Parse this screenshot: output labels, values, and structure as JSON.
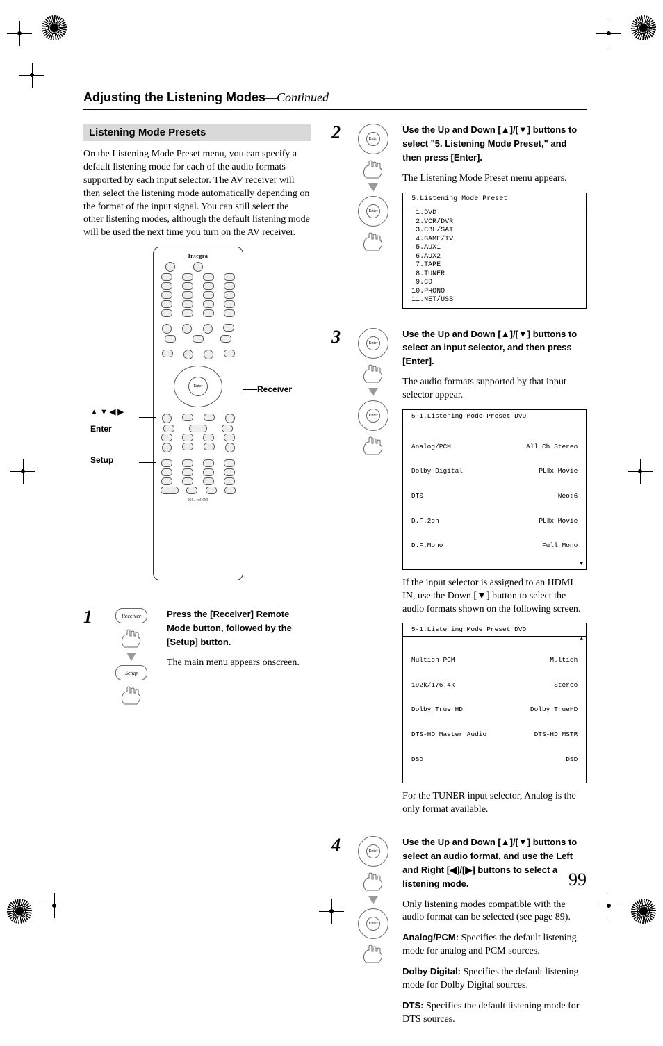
{
  "header": {
    "title": "Adjusting the Listening Modes",
    "continued": "—Continued"
  },
  "left": {
    "section_title": "Listening Mode Presets",
    "intro": "On the Listening Mode Preset menu, you can specify a default listening mode for each of the audio formats supported by each input selector. The AV receiver will then select the listening mode automatically depending on the format of the input signal. You can still select the other listening modes, although the default listening mode will be used the next time you turn on the AV receiver.",
    "remote": {
      "brand": "Integra",
      "model": "RC-688M"
    },
    "callouts": {
      "receiver": "Receiver",
      "arrows_symbols": "▲ ▼ ◀ ▶",
      "enter": "Enter",
      "setup": "Setup"
    },
    "step1": {
      "number": "1",
      "receiver_btn": "Receiver",
      "setup_btn": "Setup",
      "bold": "Press the [Receiver] Remote Mode button, followed by the [Setup] button.",
      "body": "The main menu appears onscreen."
    }
  },
  "right": {
    "step2": {
      "number": "2",
      "enter_label": "Enter",
      "bold_a": "Use the Up and Down [",
      "bold_b": "]/[",
      "bold_c": "] buttons to select \"5. Listening Mode Preset,\" and then press [Enter].",
      "body": "The Listening Mode Preset menu appears.",
      "osd": {
        "title": " 5.Listening Mode Preset",
        "lines": "  1.DVD\n  2.VCR/DVR\n  3.CBL/SAT\n  4.GAME/TV\n  5.AUX1\n  6.AUX2\n  7.TAPE\n  8.TUNER\n  9.CD\n 10.PHONO\n 11.NET/USB"
      }
    },
    "step3": {
      "number": "3",
      "enter_label": "Enter",
      "bold_a": "Use the Up and Down [",
      "bold_b": "]/[",
      "bold_c": "] buttons to select an input selector, and then press [Enter].",
      "body1": "The audio formats supported by that input selector appear.",
      "osd1": {
        "title": " 5-1.Listening Mode Preset DVD",
        "rows": [
          {
            "l": " Analog/PCM",
            "r": "All Ch Stereo "
          },
          {
            "l": " Dolby Digital",
            "r": "PLⅡx Movie "
          },
          {
            "l": " DTS",
            "r": "Neo:6 "
          },
          {
            "l": " D.F.2ch",
            "r": "PLⅡx Movie "
          },
          {
            "l": " D.F.Mono",
            "r": "Full Mono "
          }
        ]
      },
      "body2": "If the input selector is assigned to an HDMI IN, use the Down [▼] button to select the audio formats shown on the following screen.",
      "osd2": {
        "title": " 5-1.Listening Mode Preset DVD",
        "rows": [
          {
            "l": " Multich PCM",
            "r": "Multich "
          },
          {
            "l": " 192k/176.4k",
            "r": "Stereo "
          },
          {
            "l": " Dolby True HD",
            "r": "Dolby TrueHD "
          },
          {
            "l": " DTS-HD Master Audio",
            "r": "DTS-HD MSTR "
          },
          {
            "l": " DSD",
            "r": "DSD "
          }
        ]
      },
      "body3": "For the TUNER input selector, Analog is the only format available."
    },
    "step4": {
      "number": "4",
      "enter_label": "Enter",
      "bold_a": "Use the Up and Down [",
      "bold_b": "]/[",
      "bold_c": "] buttons to select an audio format, and use the Left and Right [",
      "bold_d": "]/[",
      "bold_e": "] buttons to select a listening mode.",
      "body1": "Only listening modes compatible with the audio format can be selected (see page 89).",
      "ap_label": "Analog/PCM:",
      "ap_body": " Specifies the default listening mode for analog and PCM sources.",
      "dd_label": "Dolby Digital:",
      "dd_body": " Specifies the default listening mode for Dolby Digital sources.",
      "dts_label": "DTS:",
      "dts_body": " Specifies the default listening mode for DTS sources."
    }
  },
  "page_number": "99"
}
